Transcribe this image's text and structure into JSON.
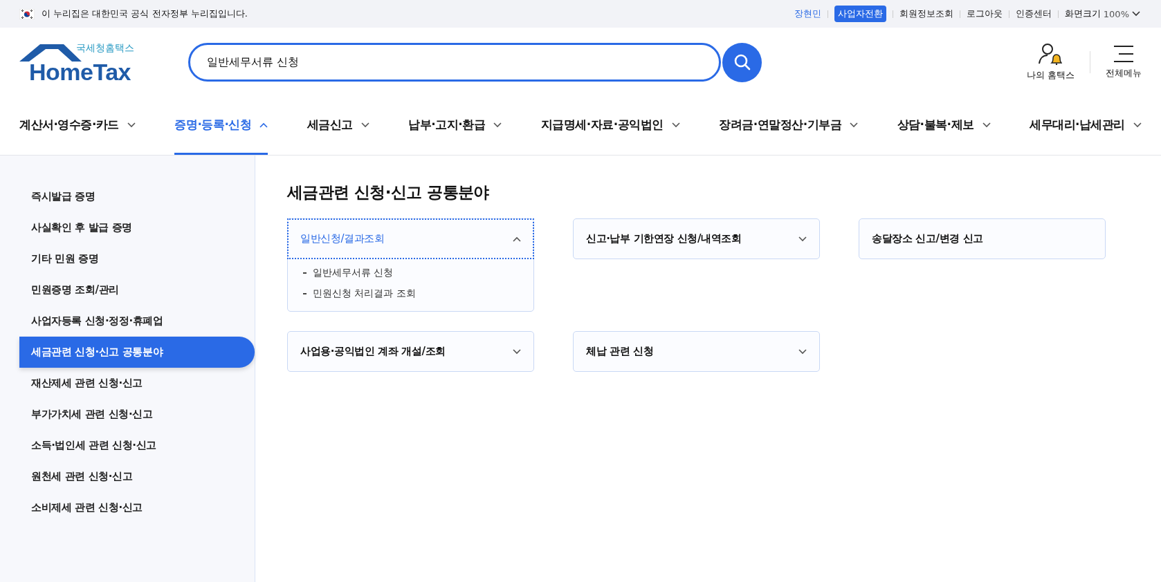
{
  "gov_banner": {
    "text": "이 누리집은 대한민국 공식 전자정부 누리집입니다."
  },
  "utility_links": [
    {
      "kind": "user",
      "label": "장현민"
    },
    {
      "kind": "badge",
      "label": "사업자전환"
    },
    {
      "kind": "link",
      "label": "회원정보조회"
    },
    {
      "kind": "link",
      "label": "로그아웃"
    },
    {
      "kind": "link",
      "label": "인증센터"
    },
    {
      "kind": "zoom",
      "label": "화면크기",
      "value": "100%"
    }
  ],
  "logo": {
    "subtitle": "국세청홈택스",
    "title": "HomeTax"
  },
  "search": {
    "value": "일반세무서류 신청"
  },
  "header_actions": [
    {
      "kind": "my",
      "label": "나의 홈택스"
    },
    {
      "kind": "menu",
      "label": "전체메뉴"
    }
  ],
  "nav": [
    {
      "label": "계산서·영수증·카드",
      "selected": false
    },
    {
      "label": "증명·등록·신청",
      "selected": true
    },
    {
      "label": "세금신고",
      "selected": false
    },
    {
      "label": "납부·고지·환급",
      "selected": false
    },
    {
      "label": "지급명세·자료·공익법인",
      "selected": false
    },
    {
      "label": "장려금·연말정산·기부금",
      "selected": false
    },
    {
      "label": "상담·불복·제보",
      "selected": false
    },
    {
      "label": "세무대리·납세관리",
      "selected": false
    }
  ],
  "sidebar": {
    "items": [
      {
        "label": "즉시발급 증명",
        "selected": false
      },
      {
        "label": "사실확인 후 발급 증명",
        "selected": false
      },
      {
        "label": "기타 민원 증명",
        "selected": false
      },
      {
        "label": "민원증명 조회/관리",
        "selected": false
      },
      {
        "label": "사업자등록 신청·정정·휴폐업",
        "selected": false
      },
      {
        "label": "세금관련 신청·신고 공통분야",
        "selected": true
      },
      {
        "label": "재산제세 관련 신청·신고",
        "selected": false
      },
      {
        "label": "부가가치세 관련 신청·신고",
        "selected": false
      },
      {
        "label": "소득·법인세 관련 신청·신고",
        "selected": false
      },
      {
        "label": "원천세 관련 신청·신고",
        "selected": false
      },
      {
        "label": "소비제세 관련 신청·신고",
        "selected": false
      }
    ]
  },
  "content": {
    "title": "세금관련 신청·신고 공통분야",
    "cards": [
      {
        "kind": "accordion",
        "label": "일반신청/결과조회",
        "expanded": true,
        "focused": true,
        "items": [
          "일반세무서류 신청",
          "민원신청 처리결과 조회"
        ]
      },
      {
        "kind": "accordion",
        "label": "신고·납부 기한연장 신청/내역조회",
        "expanded": false,
        "focused": false
      },
      {
        "kind": "link",
        "label": "송달장소 신고/변경 신고",
        "focused": false
      },
      {
        "kind": "accordion",
        "label": "사업용·공익법인 계좌 개설/조회",
        "expanded": false,
        "focused": false
      },
      {
        "kind": "accordion",
        "label": "체납 관련 신청",
        "expanded": false,
        "focused": false
      }
    ]
  }
}
